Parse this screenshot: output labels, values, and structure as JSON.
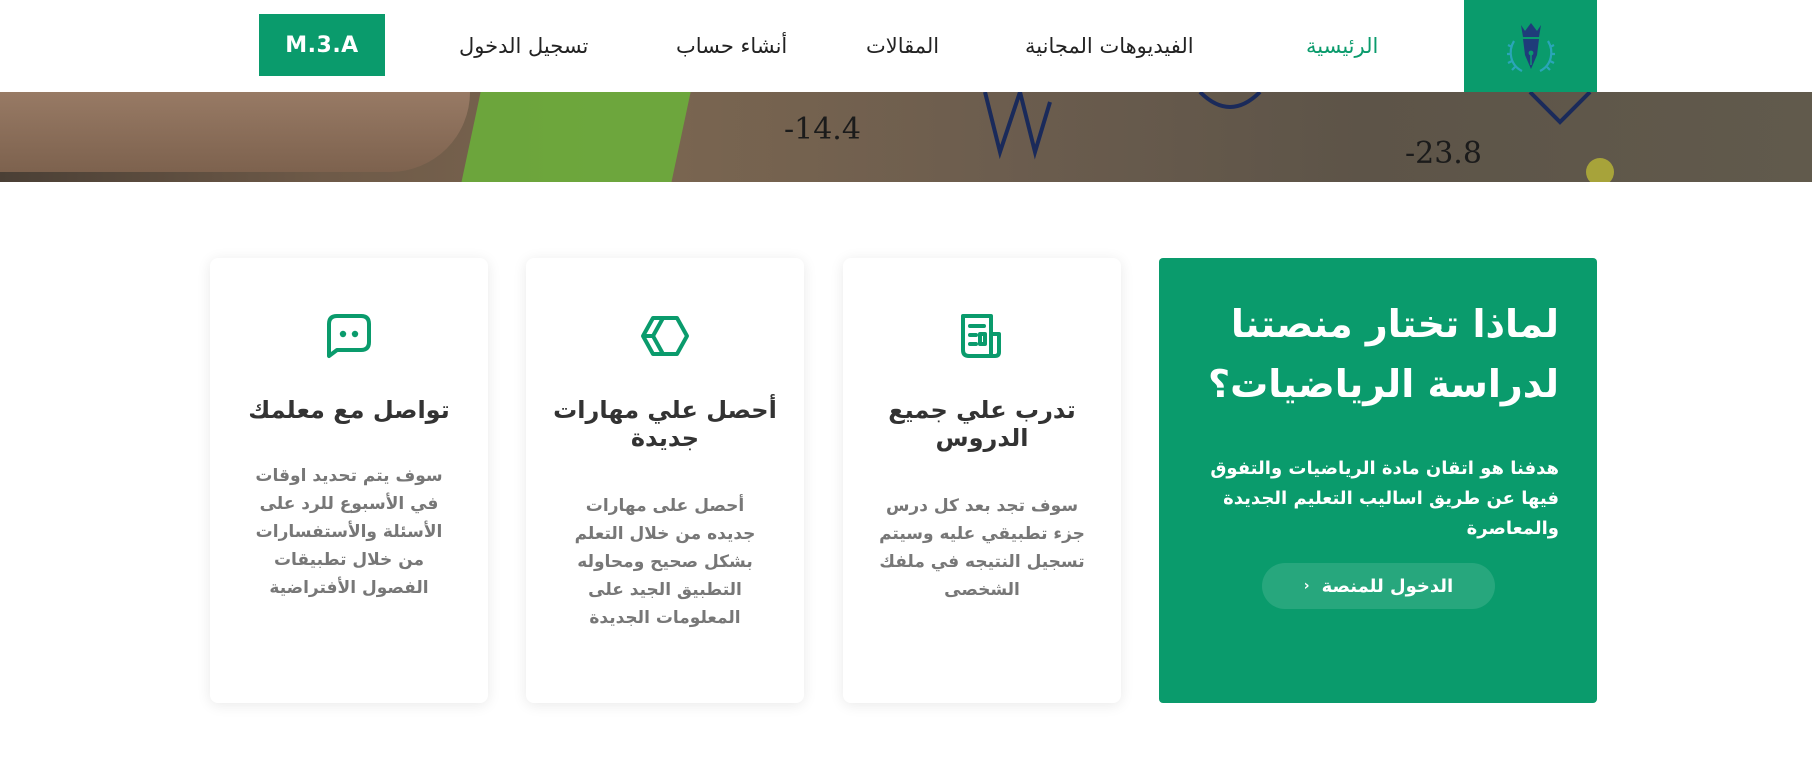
{
  "header": {
    "brand_button": "M.3.A",
    "nav": {
      "login": "تسجيل الدخول",
      "create_account": "أنشاء حساب",
      "articles": "المقالات",
      "free_videos": "الفيديوهات المجانية",
      "home": "الرئيسية"
    },
    "logo_icon": "fountain-pen-crown-icon",
    "accent_color": "#0a9b6c"
  },
  "hero": {
    "numbers": [
      "-14.4",
      "-23.8"
    ]
  },
  "why": {
    "title": "لماذا تختار منصتنا لدراسة الرياضيات؟",
    "text": "هدفنا هو اتقان مادة الرياضيات والتفوق فيها عن طريق اساليب التعليم الجديدة والمعاصرة",
    "button_label": "الدخول للمنصة",
    "button_icon": "chevron-left-icon"
  },
  "cards": [
    {
      "icon": "document-icon",
      "title": "تدرب علي جميع الدروس",
      "text": "سوف تجد بعد كل درس جزء تطبيقي عليه وسيتم تسجيل النتيجه في ملفك الشخصى"
    },
    {
      "icon": "cube-icon",
      "title": "أحصل علي مهارات جديدة",
      "text": "أحصل على مهارات جديده من خلال التعلم بشكل صحيح ومحاوله التطبيق الجيد على المعلومات الجديدة"
    },
    {
      "icon": "chat-icon",
      "title": "تواصل مع معلمك",
      "text": "سوف يتم تحديد اوقات في الأسبوع للرد على الأسئلة والأستفسارات من خلال تطبيقات الفصول الأفتراضية"
    }
  ]
}
